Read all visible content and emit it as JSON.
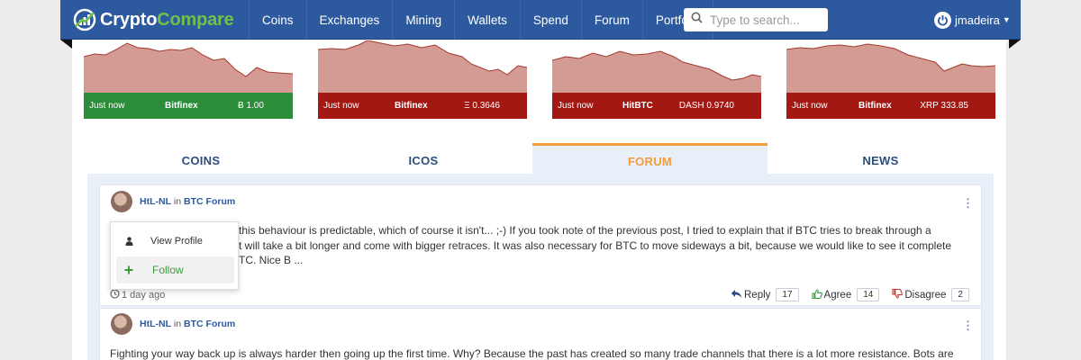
{
  "brand": {
    "name_part1": "Crypto",
    "name_part2": "Compare"
  },
  "nav": {
    "items": [
      "Coins",
      "Exchanges",
      "Mining",
      "Wallets",
      "Spend",
      "Forum",
      "Portfolio"
    ]
  },
  "search": {
    "placeholder": "Type to search..."
  },
  "user": {
    "name": "jmadeira"
  },
  "tickers": [
    {
      "time": "Just now",
      "exchange": "Bitfinex",
      "price": "Ƀ 1.00",
      "status": "up",
      "color": "#2b8c3a"
    },
    {
      "time": "Just now",
      "exchange": "Bitfinex",
      "price": "Ξ 0.3646",
      "status": "down",
      "color": "#a31812"
    },
    {
      "time": "Just now",
      "exchange": "HitBTC",
      "price": "DASH 0.9740",
      "status": "down",
      "color": "#a31812"
    },
    {
      "time": "Just now",
      "exchange": "Bitfinex",
      "price": "XRP 333.85",
      "status": "down",
      "color": "#a31812"
    }
  ],
  "tabs": [
    {
      "label": "COINS",
      "active": false
    },
    {
      "label": "ICOS",
      "active": false
    },
    {
      "label": "FORUM",
      "active": true
    },
    {
      "label": "NEWS",
      "active": false
    }
  ],
  "posts": [
    {
      "author": "HtL-NL",
      "in_word": "in",
      "forum": "BTC Forum",
      "lines": [
        "this behaviour is predictable, which of course it isn't... ;-) If you took note of the previous post, I tried to explain that if BTC tries to break through a",
        "t will take a bit longer and come with bigger retraces. It was also necessary for BTC to move sideways a bit, because we would like to see it complete",
        "TC. Nice B ..."
      ],
      "time": "1 day ago",
      "reply_label": "Reply",
      "reply_count": "17",
      "agree_label": "Agree",
      "agree_count": "14",
      "disagree_label": "Disagree",
      "disagree_count": "2"
    },
    {
      "author": "HtL-NL",
      "in_word": "in",
      "forum": "BTC Forum",
      "lines": [
        "Fighting your way back up is always harder then going up the first time. Why? Because the past has created so many trade channels that there is a lot more resistance. Bots are"
      ]
    }
  ],
  "popover": {
    "view_profile": "View Profile",
    "follow": "Follow"
  },
  "colors": {
    "nav_bg": "#2d5a9e",
    "accent_orange": "#f39c3c",
    "green": "#2b8c3a",
    "red": "#a31812"
  }
}
